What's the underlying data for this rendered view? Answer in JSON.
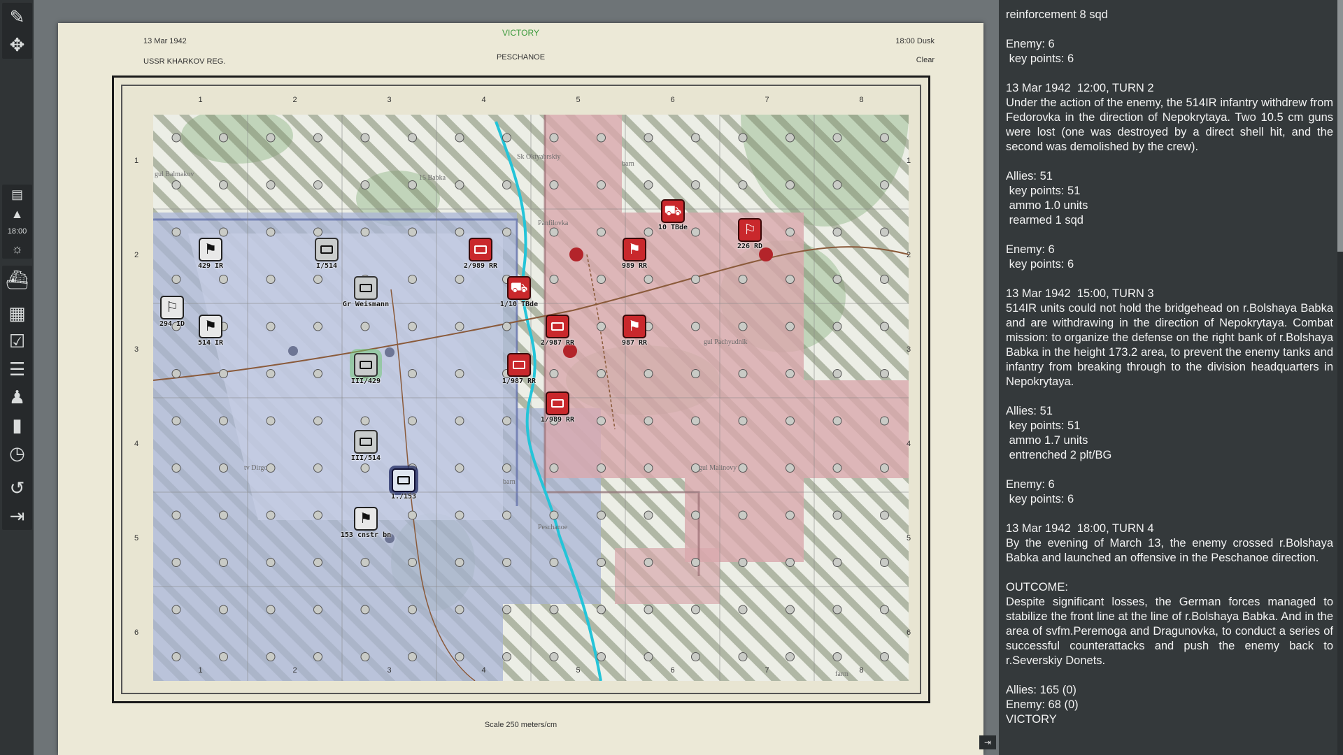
{
  "header": {
    "result": "VICTORY",
    "date": "13 Mar 1942",
    "region": "USSR KHARKOV REG.",
    "location": "PESCHANOE",
    "time": "18:00 Dusk",
    "weather": "Clear",
    "scale": "Scale 250 meters/cm"
  },
  "grid": {
    "columns": [
      "1",
      "2",
      "3",
      "4",
      "5",
      "6",
      "7",
      "8"
    ],
    "rows": [
      "1",
      "2",
      "3",
      "4",
      "5",
      "6"
    ]
  },
  "toolbar": {
    "time_label": "18:00",
    "icons": [
      "measure-icon",
      "move-icon",
      "notes-icon",
      "up-arrow-icon",
      "sun-icon",
      "ship-icon",
      "map-icon",
      "checklist-icon",
      "tree-list-icon",
      "group-icon",
      "chart-icon",
      "clock-icon",
      "undo-icon",
      "exit-icon"
    ]
  },
  "colors": {
    "friendly_zone": "#aab4d6",
    "enemy_zone": "#d9a8ad",
    "enemy_counter": "#c9282c",
    "log_bg": "#34393b",
    "river": "#24c4d8",
    "victory": "#3c9a3c"
  },
  "map_text": {
    "place_names": [
      "Panfilovka",
      "Peschanoe",
      "gul Balmakov",
      "gul Malinovy",
      "barn",
      "barn",
      "farm",
      "gul Pachyudnik",
      "Sk Oktyabrskiy",
      "15 Babka",
      "tv Dirgo"
    ]
  },
  "units": [
    {
      "label": "429 IR",
      "side": "friendly",
      "symbol": "flag"
    },
    {
      "label": "I/514",
      "side": "friendly-armor",
      "symbol": "box"
    },
    {
      "label": "Gr Weismann",
      "side": "friendly-armor",
      "symbol": "box"
    },
    {
      "label": "294 ID",
      "side": "friendly",
      "symbol": "pennant"
    },
    {
      "label": "514 IR",
      "side": "friendly",
      "symbol": "flag"
    },
    {
      "label": "III/429",
      "side": "friendly-armor",
      "symbol": "box",
      "selected": true
    },
    {
      "label": "III/514",
      "side": "friendly-armor",
      "symbol": "box"
    },
    {
      "label": "1./153",
      "side": "hq",
      "symbol": "box"
    },
    {
      "label": "153 cnstr bn",
      "side": "friendly",
      "symbol": "flag"
    },
    {
      "label": "2/989 RR",
      "side": "enemy",
      "symbol": "box"
    },
    {
      "label": "1/10 TBde",
      "side": "enemy",
      "symbol": "tank"
    },
    {
      "label": "10 TBde",
      "side": "enemy",
      "symbol": "tank"
    },
    {
      "label": "989 RR",
      "side": "enemy",
      "symbol": "flag"
    },
    {
      "label": "226 RD",
      "side": "enemy",
      "symbol": "pennant"
    },
    {
      "label": "2/987 RR",
      "side": "enemy",
      "symbol": "box"
    },
    {
      "label": "987 RR",
      "side": "enemy",
      "symbol": "flag"
    },
    {
      "label": "1/987 RR",
      "side": "enemy",
      "symbol": "box"
    },
    {
      "label": "1/989 RR",
      "side": "enemy",
      "symbol": "box"
    }
  ],
  "log": {
    "entries": [
      {
        "kind": "stat",
        "text": "reinforcement 8 sqd"
      },
      {
        "kind": "stat",
        "text": "Enemy: 6\n key points: 6"
      },
      {
        "kind": "text",
        "text": "13 Mar 1942  12:00, TURN 2\nUnder the action of the enemy, the 514IR infantry withdrew from Fedorovka in the direction of Nepokrytaya. Two 10.5 cm guns were lost (one was destroyed by a direct shell hit, and the second was demolished by the crew)."
      },
      {
        "kind": "stat",
        "text": "Allies: 51\n key points: 51\n ammo 1.0 units\n rearmed 1 sqd"
      },
      {
        "kind": "stat",
        "text": "Enemy: 6\n key points: 6"
      },
      {
        "kind": "text",
        "text": "13 Mar 1942  15:00, TURN 3\n514IR units could not hold the bridgehead on r.Bolshaya Babka and are withdrawing in the direction of Nepokrytaya. Combat mission: to organize the defense on the right bank of r.Bolshaya Babka in the height 173.2 area, to prevent the enemy tanks and infantry from breaking through to the division headquarters in Nepokrytaya."
      },
      {
        "kind": "stat",
        "text": "Allies: 51\n key points: 51\n ammo 1.7 units\n entrenched 2 plt/BG"
      },
      {
        "kind": "stat",
        "text": "Enemy: 6\n key points: 6"
      },
      {
        "kind": "text",
        "text": "13 Mar 1942  18:00, TURN 4\nBy the evening of March 13, the enemy crossed r.Bolshaya Babka and launched an offensive in the Peschanoe direction."
      },
      {
        "kind": "text",
        "text": "OUTCOME:\nDespite significant losses, the German forces managed to stabilize the front line at the line of r.Bolshaya Babka. And in the area of svfm.Peremoga and Dragunovka, to conduct a series of successful counterattacks and push the enemy back to r.Severskiy Donets."
      },
      {
        "kind": "stat",
        "text": "Allies: 165 (0)\nEnemy: 68 (0)\nVICTORY"
      }
    ]
  }
}
